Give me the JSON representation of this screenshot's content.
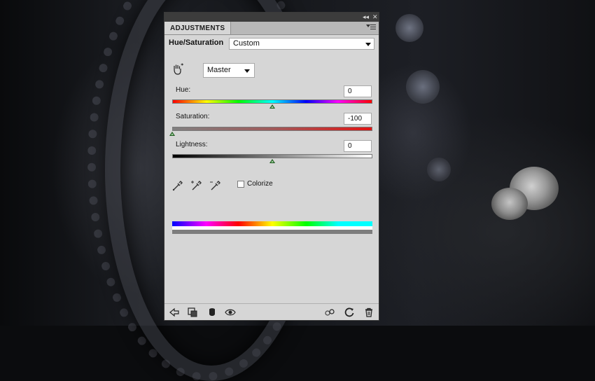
{
  "panel": {
    "tab_label": "ADJUSTMENTS",
    "collapse_glyph": "◂◂",
    "close_glyph": "✕"
  },
  "adjustment": {
    "name": "Hue/Saturation",
    "preset": "Custom",
    "channel": "Master"
  },
  "sliders": {
    "hue": {
      "label": "Hue:",
      "value": "0",
      "level": 0.5
    },
    "saturation": {
      "label": "Saturation:",
      "value": "-100",
      "level": 0.0
    },
    "lightness": {
      "label": "Lightness:",
      "value": "0",
      "level": 0.5
    }
  },
  "colorize": {
    "label": "Colorize",
    "checked": false
  },
  "icons": {
    "targeted_adjustment": "hand-scrub-icon",
    "eyedroppers": [
      "eyedropper-icon",
      "eyedropper-plus-icon",
      "eyedropper-minus-icon"
    ],
    "bottom_left": [
      "back-arrow-icon",
      "clip-layer-icon",
      "mask-icon",
      "visibility-eye-icon"
    ],
    "bottom_right": [
      "previous-state-icon",
      "reset-icon",
      "trash-icon"
    ]
  }
}
